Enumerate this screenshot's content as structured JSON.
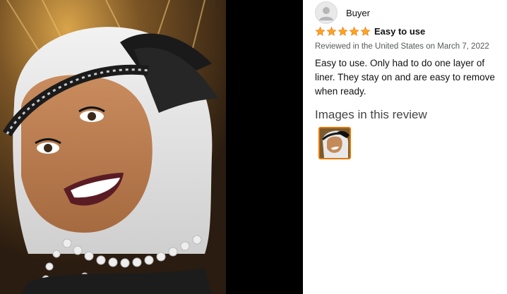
{
  "review": {
    "reviewer_name": "Buyer",
    "star_rating": 5,
    "star_max": 5,
    "headline": "Easy to use",
    "meta": "Reviewed in the United States on March 7, 2022",
    "body": "Easy to use. Only had to do one layer of liner. They stay on and are easy to remove when ready.",
    "images_heading": "Images in this review"
  },
  "colors": {
    "star": "#ffa41c",
    "star_outline": "#de7921",
    "thumb_border": "#e77600",
    "meta_text": "#565959"
  },
  "icons": {
    "avatar": "default-avatar-icon",
    "star": "star-icon"
  }
}
